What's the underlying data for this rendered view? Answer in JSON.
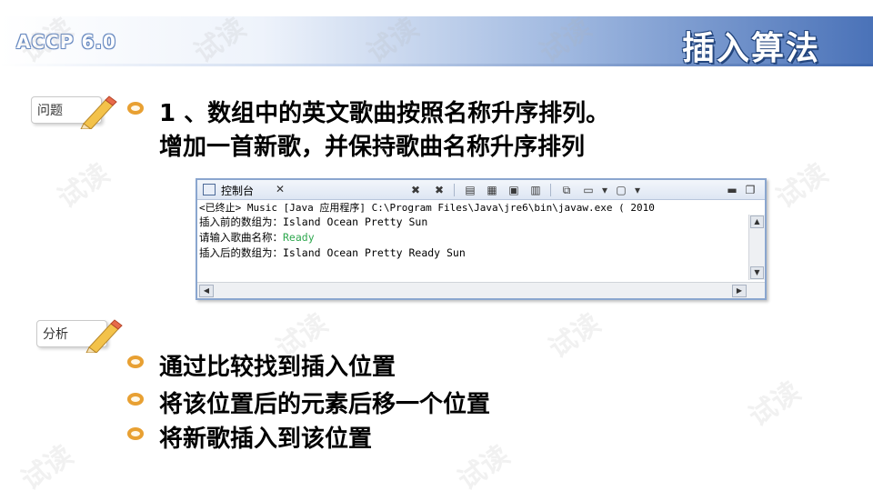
{
  "brand": "ACCP 6.0",
  "title": "插入算法",
  "watermark": "试读",
  "question_tag": "问题",
  "analysis_tag": "分析",
  "question_lines": [
    "1 、数组中的英文歌曲按照名称升序排列。",
    "增加一首新歌，并保持歌曲名称升序排列"
  ],
  "console": {
    "tab_label": "控制台",
    "tab_close": "✕",
    "status": "<已终止> Music [Java 应用程序] C:\\Program Files\\Java\\jre6\\bin\\javaw.exe ( 2010",
    "lines": {
      "before_label": "插入前的数组为：",
      "before_values": "Island   Ocean   Pretty   Sun",
      "prompt_label": "请输入歌曲名称：",
      "prompt_input": "Ready",
      "after_label": "插入后的数组为：",
      "after_values": "Island   Ocean   Pretty   Ready   Sun"
    }
  },
  "analysis_points": [
    "通过比较找到插入位置",
    "将该位置后的元素后移一个位置",
    "将新歌插入到该位置"
  ],
  "colors": {
    "bullet": "#e8a032",
    "header_dark": "#4a72b8",
    "input_green": "#2fa84f"
  }
}
